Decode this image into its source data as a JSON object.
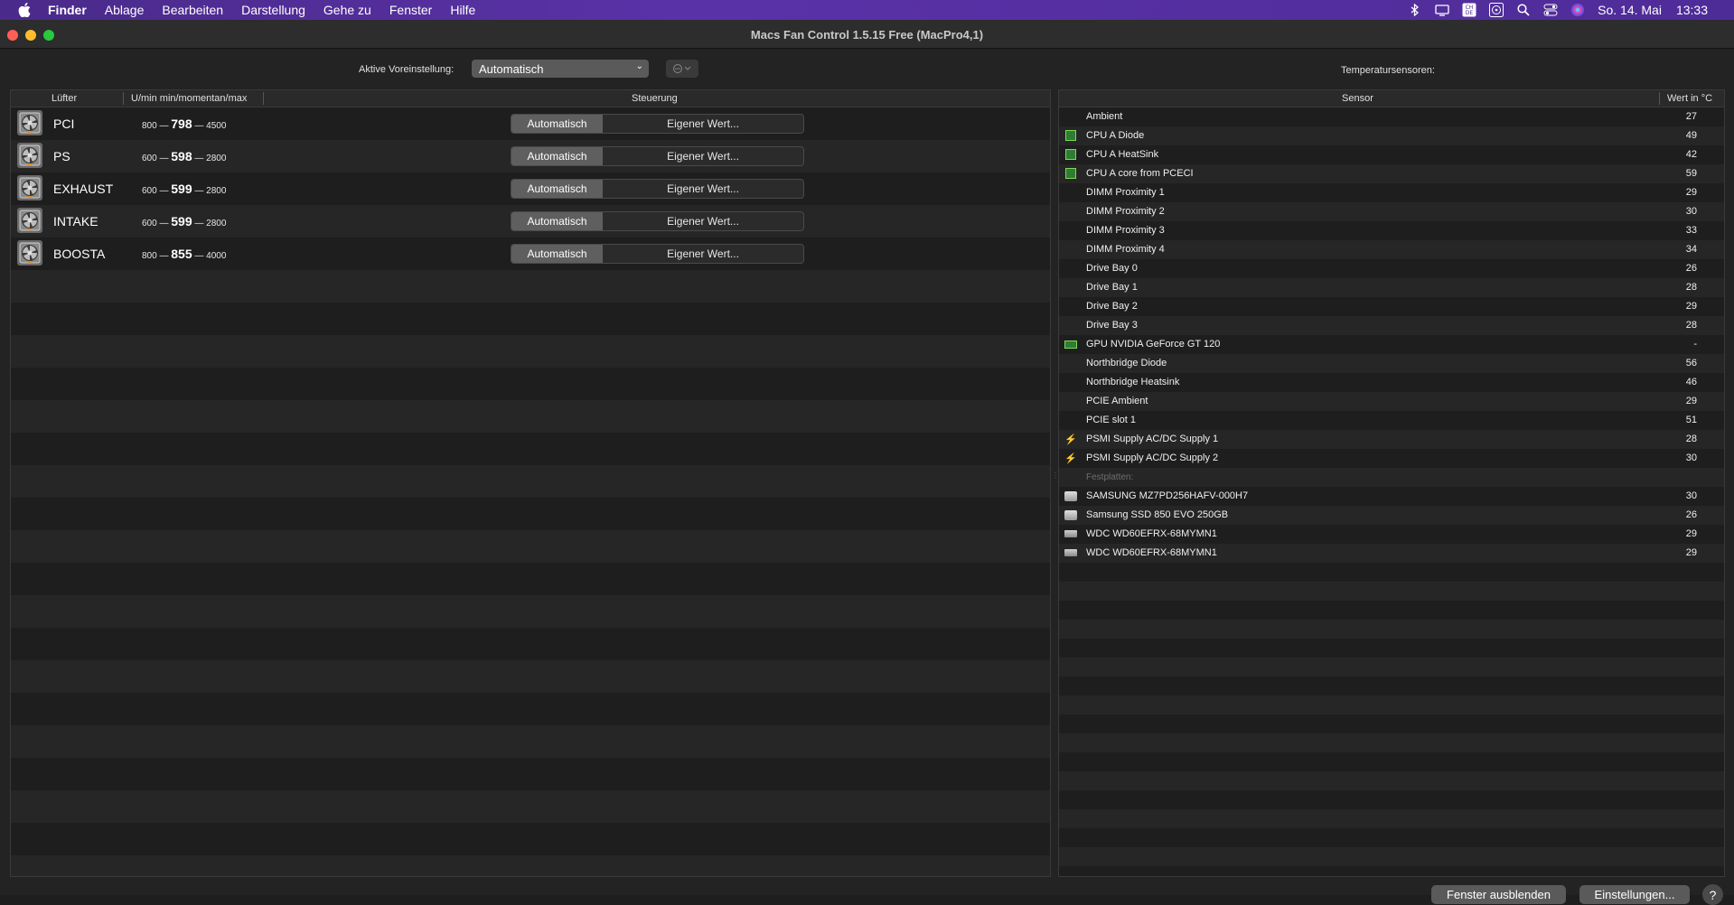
{
  "menubar": {
    "items": [
      "Finder",
      "Ablage",
      "Bearbeiten",
      "Darstellung",
      "Gehe zu",
      "Fenster",
      "Hilfe"
    ],
    "date": "So. 14. Mai",
    "time": "13:33",
    "icons": [
      "bluetooth-icon",
      "display-icon",
      "keyboard-layout-icon",
      "fan-control-icon",
      "spotlight-icon",
      "control-center-icon",
      "siri-icon"
    ]
  },
  "window": {
    "title": "Macs Fan Control 1.5.15 Free (MacPro4,1)"
  },
  "toolbar": {
    "preset_label": "Aktive Voreinstellung:",
    "preset_value": "Automatisch",
    "sensors_label": "Temperatursensoren:"
  },
  "fan_table": {
    "headers": {
      "fan": "Lüfter",
      "speed": "U/min min/momentan/max",
      "control": "Steuerung"
    },
    "rows": [
      {
        "name": "PCI",
        "min": "800 —",
        "current": "798",
        "max": "— 4500",
        "auto": "Automatisch",
        "custom": "Eigener Wert..."
      },
      {
        "name": "PS",
        "min": "600 —",
        "current": "598",
        "max": "— 2800",
        "auto": "Automatisch",
        "custom": "Eigener Wert..."
      },
      {
        "name": "EXHAUST",
        "min": "600 —",
        "current": "599",
        "max": "— 2800",
        "auto": "Automatisch",
        "custom": "Eigener Wert..."
      },
      {
        "name": "INTAKE",
        "min": "600 —",
        "current": "599",
        "max": "— 2800",
        "auto": "Automatisch",
        "custom": "Eigener Wert..."
      },
      {
        "name": "BOOSTA",
        "min": "800 —",
        "current": "855",
        "max": "— 4000",
        "auto": "Automatisch",
        "custom": "Eigener Wert..."
      }
    ]
  },
  "sensor_table": {
    "headers": {
      "sensor": "Sensor",
      "value": "Wert in °C"
    },
    "rows": [
      {
        "name": "Ambient",
        "value": "27",
        "icon": ""
      },
      {
        "name": "CPU A Diode",
        "value": "49",
        "icon": "chip"
      },
      {
        "name": "CPU A HeatSink",
        "value": "42",
        "icon": "chip"
      },
      {
        "name": "CPU A core from PCECI",
        "value": "59",
        "icon": "chip"
      },
      {
        "name": "DIMM Proximity 1",
        "value": "29",
        "icon": ""
      },
      {
        "name": "DIMM Proximity 2",
        "value": "30",
        "icon": ""
      },
      {
        "name": "DIMM Proximity 3",
        "value": "33",
        "icon": ""
      },
      {
        "name": "DIMM Proximity 4",
        "value": "34",
        "icon": ""
      },
      {
        "name": "Drive Bay 0",
        "value": "26",
        "icon": ""
      },
      {
        "name": "Drive Bay 1",
        "value": "28",
        "icon": ""
      },
      {
        "name": "Drive Bay 2",
        "value": "29",
        "icon": ""
      },
      {
        "name": "Drive Bay 3",
        "value": "28",
        "icon": ""
      },
      {
        "name": "GPU NVIDIA GeForce GT 120",
        "value": "-",
        "icon": "gpu"
      },
      {
        "name": "Northbridge Diode",
        "value": "56",
        "icon": ""
      },
      {
        "name": "Northbridge Heatsink",
        "value": "46",
        "icon": ""
      },
      {
        "name": "PCIE Ambient",
        "value": "29",
        "icon": ""
      },
      {
        "name": "PCIE slot 1",
        "value": "51",
        "icon": ""
      },
      {
        "name": "PSMI Supply AC/DC Supply 1",
        "value": "28",
        "icon": "bolt"
      },
      {
        "name": "PSMI Supply AC/DC Supply 2",
        "value": "30",
        "icon": "bolt"
      },
      {
        "name": "Festplatten:",
        "value": "",
        "icon": "group"
      },
      {
        "name": "SAMSUNG MZ7PD256HAFV-000H7",
        "value": "30",
        "icon": "disk"
      },
      {
        "name": "Samsung SSD 850 EVO 250GB",
        "value": "26",
        "icon": "disk"
      },
      {
        "name": "WDC WD60EFRX-68MYMN1",
        "value": "29",
        "icon": "hdd"
      },
      {
        "name": "WDC WD60EFRX-68MYMN1",
        "value": "29",
        "icon": "hdd"
      }
    ]
  },
  "footer": {
    "hide_label": "Fenster ausblenden",
    "settings_label": "Einstellungen...",
    "help_label": "?"
  }
}
